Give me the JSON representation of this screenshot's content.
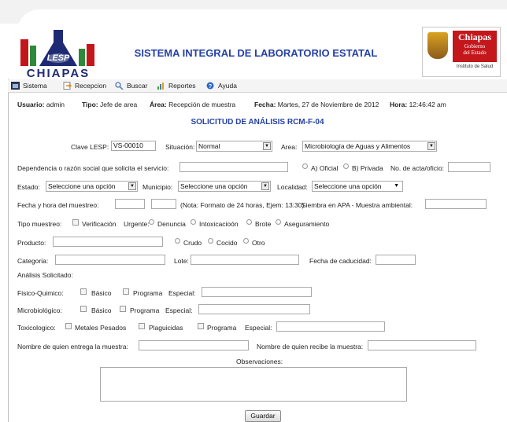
{
  "header": {
    "logo_text": "CHIAPAS",
    "logo_badge": "LESP",
    "title": "SISTEMA INTEGRAL DE LABORATORIO ESTATAL",
    "gov_logo": {
      "line1": "Chiapas",
      "line2": "Gobierno",
      "line3": "del Estado",
      "caption": "Instituto de Salud"
    }
  },
  "menu": [
    {
      "label": "Sistema",
      "icon": "window-icon"
    },
    {
      "label": "Recepcion",
      "icon": "arrow-doc-icon"
    },
    {
      "label": "Buscar",
      "icon": "search-icon"
    },
    {
      "label": "Reportes",
      "icon": "chart-icon"
    },
    {
      "label": "Ayuda",
      "icon": "help-icon"
    }
  ],
  "info": {
    "usuario_label": "Usuario:",
    "usuario_value": "admin",
    "tipo_label": "Tipo:",
    "tipo_value": "Jefe de area",
    "area_label": "Área:",
    "area_value": "Recepción de muestra",
    "fecha_label": "Fecha:",
    "fecha_value": "Martes, 27 de Noviembre de 2012",
    "hora_label": "Hora:",
    "hora_value": "12:46:42 am"
  },
  "form": {
    "title": "SOLICITUD DE ANÁLISIS RCM-F-04",
    "clave_label": "Clave LESP:",
    "clave_value": "VS-00010",
    "situacion_label": "Situación:",
    "situacion_value": "Normal",
    "area_label": "Area:",
    "area_value": "Microbiología de Aguas y Alimentos",
    "dependencia_label": "Dependencia o razón social que solicita el servicio:",
    "oficial_label": "A) Oficial",
    "privada_label": "B) Privada",
    "acta_label": "No. de acta/oficio:",
    "estado_label": "Estado:",
    "estado_value": "Seleccione una opción",
    "municipio_label": "Municipio:",
    "municipio_value": "Seleccione una opción",
    "localidad_label": "Localidad:",
    "localidad_value": "Seleccione una opción",
    "fecha_label": "Fecha y hora del muestreo:",
    "nota_label": "(Nota: Formato de 24 horas, Ejem: 13:30)",
    "siembra_label": "Siembra en APA - Muestra ambiental:",
    "tipo_label": "Tipo muestreo:",
    "tipo_options": [
      "Verificación",
      "Urgente:",
      "Denuncia",
      "Intoxicacioón",
      "Brote",
      "Aseguramiento"
    ],
    "producto_label": "Producto:",
    "producto_options": [
      "Crudo",
      "Cocido",
      "Otro"
    ],
    "categoria_label": "Categoria:",
    "lote_label": "Lote:",
    "caducidad_label": "Fecha de caducidad:",
    "analisis_label": "Análisis Solicitado:",
    "fisico_label": "Fisico-Quimico:",
    "basico_label": "Básico",
    "programa_label": "Programa",
    "especial_label": "Especial:",
    "micro_label": "Microbiológico:",
    "toxico_label": "Toxicologico:",
    "metales_label": "Metales Pesados",
    "plaguicidas_label": "Plaguicidas",
    "entrega_label": "Nombre de quien entrega la muestra:",
    "recibe_label": "Nombre de quien recibe la muestra:",
    "observaciones_label": "Observaciones:",
    "guardar_label": "Guardar"
  }
}
